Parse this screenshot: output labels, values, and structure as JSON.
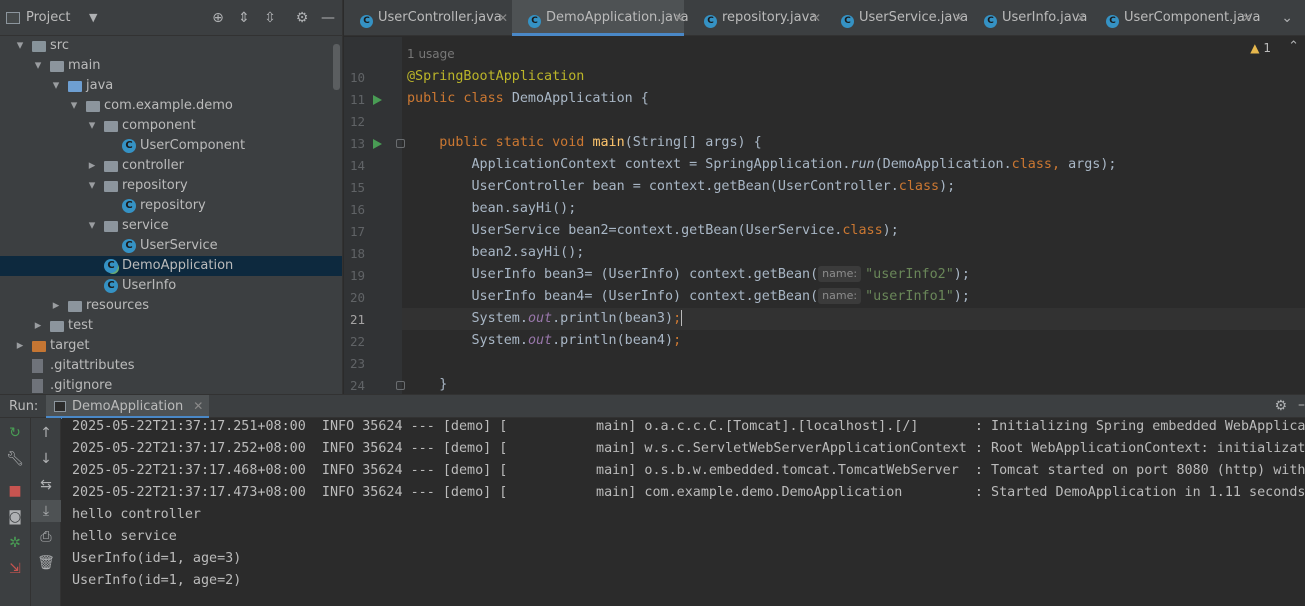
{
  "project_panel": {
    "title": "Project",
    "tree": [
      {
        "label": "src",
        "depth": 1,
        "arrow": "open",
        "icon": "folder-src"
      },
      {
        "label": "main",
        "depth": 2,
        "arrow": "open",
        "icon": "folder"
      },
      {
        "label": "java",
        "depth": 3,
        "arrow": "open",
        "icon": "folder-java"
      },
      {
        "label": "com.example.demo",
        "depth": 4,
        "arrow": "open",
        "icon": "package"
      },
      {
        "label": "component",
        "depth": 5,
        "arrow": "open",
        "icon": "package"
      },
      {
        "label": "UserComponent",
        "depth": 6,
        "arrow": "none",
        "icon": "class"
      },
      {
        "label": "controller",
        "depth": 5,
        "arrow": "closed",
        "icon": "package"
      },
      {
        "label": "repository",
        "depth": 5,
        "arrow": "open",
        "icon": "package"
      },
      {
        "label": "repository",
        "depth": 6,
        "arrow": "none",
        "icon": "class"
      },
      {
        "label": "service",
        "depth": 5,
        "arrow": "open",
        "icon": "package"
      },
      {
        "label": "UserService",
        "depth": 6,
        "arrow": "none",
        "icon": "class"
      },
      {
        "label": "DemoApplication",
        "depth": 5,
        "arrow": "none",
        "icon": "spring-class",
        "selected": true
      },
      {
        "label": "UserInfo",
        "depth": 5,
        "arrow": "none",
        "icon": "class"
      },
      {
        "label": "resources",
        "depth": 3,
        "arrow": "closed",
        "icon": "folder-resources"
      },
      {
        "label": "test",
        "depth": 2,
        "arrow": "closed",
        "icon": "folder"
      },
      {
        "label": "target",
        "depth": 1,
        "arrow": "closed",
        "icon": "folder-orange"
      },
      {
        "label": ".gitattributes",
        "depth": 1,
        "arrow": "none",
        "icon": "file"
      },
      {
        "label": ".gitignore",
        "depth": 1,
        "arrow": "none",
        "icon": "file"
      }
    ]
  },
  "tabs": [
    {
      "label": "UserController.java",
      "active": false
    },
    {
      "label": "DemoApplication.java",
      "active": true
    },
    {
      "label": "repository.java",
      "active": false
    },
    {
      "label": "UserService.java",
      "active": false
    },
    {
      "label": "UserInfo.java",
      "active": false
    },
    {
      "label": "UserComponent.java",
      "active": false
    }
  ],
  "editor": {
    "usage_hint": "1 usage",
    "warnings": "1",
    "line_numbers": [
      "10",
      "11",
      "12",
      "13",
      "14",
      "15",
      "16",
      "17",
      "18",
      "19",
      "20",
      "21",
      "22",
      "23",
      "24"
    ],
    "current_line": "21",
    "param_hint": "name:",
    "code": {
      "l10": "@SpringBootApplication",
      "l11_kw": "public class ",
      "l11_rest": "DemoApplication {",
      "l13_kw": "public static void ",
      "l13_fn": "main",
      "l13_rest": "(String[] args) {",
      "l14_a": "ApplicationContext context = SpringApplication.",
      "l14_run": "run",
      "l14_b": "(DemoApplication.",
      "l14_kw": "class, ",
      "l14_c": "args);",
      "l15_a": "UserController bean = context.getBean(UserController.",
      "l15_kw": "class",
      "l15_c": ");",
      "l16": "bean.sayHi();",
      "l17_a": "UserService bean2=context.getBean(UserService.",
      "l17_kw": "class",
      "l17_c": ");",
      "l18": "bean2.sayHi();",
      "l19_a": "UserInfo bean3= (UserInfo) context.getBean(",
      "l19_str": "\"userInfo2\"",
      "l19_c": ");",
      "l20_a": "UserInfo bean4= (UserInfo) context.getBean(",
      "l20_str": "\"userInfo1\"",
      "l20_c": ");",
      "l21_a": "System.",
      "l21_out": "out",
      "l21_b": ".println(bean3)",
      "l21_c": ";",
      "l22_a": "System.",
      "l22_out": "out",
      "l22_b": ".println(bean4)",
      "l22_c": ";",
      "l24": "}"
    }
  },
  "run_panel": {
    "label": "Run:",
    "tab_label": "DemoApplication",
    "console_lines": [
      "2025-05-22T21:37:17.251+08:00  INFO 35624 --- [demo] [           main] o.a.c.c.C.[Tomcat].[localhost].[/]       : Initializing Spring embedded WebApplicat",
      "2025-05-22T21:37:17.252+08:00  INFO 35624 --- [demo] [           main] w.s.c.ServletWebServerApplicationContext : Root WebApplicationContext: initializati",
      "2025-05-22T21:37:17.468+08:00  INFO 35624 --- [demo] [           main] o.s.b.w.embedded.tomcat.TomcatWebServer  : Tomcat started on port 8080 (http) with",
      "2025-05-22T21:37:17.473+08:00  INFO 35624 --- [demo] [           main] com.example.demo.DemoApplication         : Started DemoApplication in 1.11 seconds",
      "hello controller",
      "hello service",
      "UserInfo(id=1, age=3)",
      "UserInfo(id=1, age=2)"
    ]
  },
  "colors": {
    "background": "#2b2b2b",
    "panel": "#3c3f41",
    "selection": "#0d293e",
    "accent": "#4a88c7",
    "keyword": "#cc7832",
    "annotation": "#bbb529",
    "function": "#ffc66d",
    "string": "#6a8759",
    "run_green": "#499c54"
  }
}
